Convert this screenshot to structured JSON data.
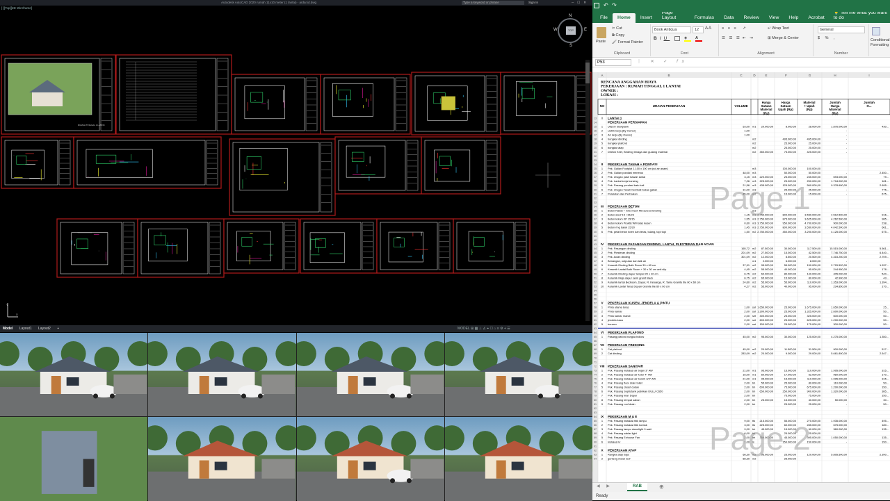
{
  "cad": {
    "title": "Autodesk AutoCAD 2020   rumah 11x10 meter (1 lantai) - ardar.id.dwg",
    "search_placeholder": "Type a keyword or phrase",
    "sign_in": "Sign In",
    "viewport_label": "[-][Top][2D Wireframe]",
    "viewcube": {
      "face": "TOP",
      "n": "N",
      "s": "S",
      "e": "E",
      "w": "W"
    },
    "layout_tabs": [
      "Model",
      "Layout1",
      "Layout2",
      "+"
    ],
    "status_right": "MODEL  ⊞ ▦ ⊥ ∠ ⌖ ☐ ⌂ ≡ ⚙ + ☰",
    "sheet_caption": "RUMAH TINGGAL 1 LANTAI"
  },
  "excel": {
    "title_hint": "",
    "menu": [
      "File",
      "Home",
      "Insert",
      "Page Layout",
      "Formulas",
      "Data",
      "Review",
      "View",
      "Help",
      "Acrobat"
    ],
    "tell_me": "Tell me what you want to do",
    "clipboard": {
      "paste": "Paste",
      "cut": "Cut",
      "copy": "Copy",
      "painter": "Format Painter",
      "label": "Clipboard"
    },
    "font": {
      "name": "Book Antiqua",
      "size": "12",
      "label": "Font"
    },
    "alignment": {
      "wrap": "Wrap Text",
      "merge": "Merge & Center",
      "label": "Alignment"
    },
    "number": {
      "format": "General",
      "label": "Number"
    },
    "styles": {
      "cond": "Conditional Formatting",
      "label": ""
    },
    "name_box": "P53",
    "fx": "fx",
    "sheet_tab": "RAB",
    "status": "Ready",
    "watermark": [
      "Page 1",
      "Page 2"
    ],
    "rab": {
      "title": "RENCANA ANGGARAN BIAYA",
      "pekerjaan": "PEKERJAAN : RUMAH TINGGAL 1 LANTAI",
      "owner": "OWNER        :",
      "lokasi": "LOKASI       :",
      "headers": [
        "NO",
        "URAIAN PEKERJAAN",
        "VOLUME",
        "",
        "Harga Satuan Material (Rp)",
        "Harga Satuan Upah (Rp)",
        "Material + Upah (Rp)",
        "Jumlah Harga Material (Rp)",
        "Jumlah H..."
      ],
      "rows": [
        [
          "I",
          "LANTAI 1",
          "",
          "",
          "",
          "",
          "",
          "",
          ""
        ],
        [
          "",
          "PEKERJAAN PERSIAPAN",
          "",
          "",
          "",
          "",
          "",
          "",
          ""
        ],
        [
          "1",
          "Uitzet / Bowplank",
          "53,00",
          "m1",
          "20.000,00",
          "8.000,00",
          "28.000,00",
          "1.876.000,00",
          "430..."
        ],
        [
          "2",
          "Listrik kerja (By Owner)",
          "1,00",
          "",
          "",
          "",
          "",
          "-",
          ""
        ],
        [
          "3",
          "Air kerja (By Owner)",
          "1,00",
          "",
          "",
          "",
          "",
          "-",
          ""
        ],
        [
          "4",
          "bongkar dinding",
          "",
          "m2",
          "",
          "495.000,00",
          "495.000,00",
          "-",
          ""
        ],
        [
          "5",
          "bongkar plafond",
          "",
          "m2",
          "",
          "25.000,00",
          "25.000,00",
          "-",
          ""
        ],
        [
          "6",
          "bongkar atap",
          "",
          "m2",
          "",
          "25.000,00",
          "25.000,00",
          "-",
          ""
        ],
        [
          "7",
          "Direksi Keet, Bedeng tenaga dan gudang material",
          "",
          "m2",
          "350.000,00",
          "75.000,00",
          "425.000,00",
          "-",
          ""
        ],
        [
          "",
          "",
          "",
          "",
          "",
          "",
          "",
          "",
          ""
        ],
        [
          "",
          "",
          "",
          "",
          "",
          "",
          "",
          "",
          ""
        ],
        [
          "II",
          "PEKERJAAN TANAH + PONDASI",
          "",
          "",
          "",
          "",
          "",
          "",
          ""
        ],
        [
          "1",
          "Pek. Galian Footplat 1.100 x 100 cm (sd air asam)",
          "",
          "m3",
          "",
          "100.000,00",
          "100.000,00",
          "",
          ""
        ],
        [
          "2",
          "Pek. Galian pondasi menerus",
          "48,00",
          "m3",
          "",
          "50.000,00",
          "50.000,00",
          "-",
          "2.450..."
        ],
        [
          "3",
          "Pek. Urugan pasir bawah lantai",
          "3,15",
          "m3",
          "220.000,00",
          "25.000,00",
          "245.000,00",
          "693.000,00",
          "79..."
        ],
        [
          "4",
          "Pek. Lantai kerja bonsing",
          "7,26",
          "m3",
          "225.000,00",
          "25.000,00",
          "250.000,00",
          "1.704.000,00",
          "181..."
        ],
        [
          "5",
          "Pek. Pasang pondasi batu kali",
          "21,56",
          "m3",
          "435.000,00",
          "125.000,00",
          "560.000,00",
          "9.378.600,00",
          "2.695..."
        ],
        [
          "6",
          "Pek. Urugan Tanah Kembali bekas galian",
          "31,00",
          "m3",
          "",
          "25.000,00",
          "25.000,00",
          "-",
          "775..."
        ],
        [
          "7",
          "Peralatan dan Perbaikan",
          "45,00",
          "m2",
          "",
          "15.000,00",
          "15.000,00",
          "-",
          "675..."
        ],
        [
          "",
          "",
          "",
          "",
          "",
          "",
          "",
          "",
          ""
        ],
        [
          "",
          "",
          "",
          "",
          "",
          "",
          "",
          "",
          ""
        ],
        [
          "III",
          "PEKERJAAN BETON",
          "",
          "",
          "",
          "",
          "",
          "",
          ""
        ],
        [
          "1",
          "Beton Rabat + wire mesh M8 screed leveling",
          "",
          "m3",
          "",
          "",
          "",
          "",
          ""
        ],
        [
          "2",
          "Beton sloof 15 / 15/23",
          "1,15",
          "m3",
          "2.750.000,00",
          "800.000,00",
          "3.550.000,00",
          "4.512.500,00",
          "916..."
        ],
        [
          "3",
          "Beton kolom KP 15/15",
          "1,55",
          "m3",
          "2.750.000,00",
          "875.000,00",
          "3.625.000,00",
          "4.262.500,00",
          "985..."
        ],
        [
          "4",
          "Beton kolom Praktis WM atas kusen",
          "0,60",
          "m3",
          "3.750.000,00",
          "950.000,00",
          "4.700.000,00",
          "900.000,00",
          "238..."
        ],
        [
          "5",
          "Beton ring balok 15/20",
          "1,45",
          "m3",
          "2.750.000,00",
          "800.000,00",
          "3.550.000,00",
          "4.042.500,00",
          "661..."
        ],
        [
          "6",
          "Pek. pelat beton toren dan teras, tulang, topi topi",
          "1,50",
          "m2",
          "2.750.000,00",
          "450.000,00",
          "3.200.000,00",
          "4.125.000,00",
          "675..."
        ],
        [
          "",
          "",
          "",
          "",
          "",
          "",
          "",
          "",
          ""
        ],
        [
          "",
          "",
          "",
          "",
          "",
          "",
          "",
          "",
          ""
        ],
        [
          "IV",
          "PEKERJAAN PASANGAN DINDING, LANTAI, PLESTERAN DAN ACIAN",
          "",
          "",
          "",
          "",
          "",
          "",
          ""
        ],
        [
          "1",
          "Pek. Pasangan dinding",
          "165,72",
          "m2",
          "87.500,00",
          "30.000,00",
          "117.500,00",
          "15.515.000,00",
          "5.561..."
        ],
        [
          "2",
          "Pek. Plesteran dinding",
          "201,09",
          "m2",
          "27.500,00",
          "15.000,00",
          "42.500,00",
          "7.746.750,00",
          "6.440..."
        ],
        [
          "3",
          "Pek. Acian dinding",
          "301,09",
          "m2",
          "12.000,00",
          "8.500,00",
          "20.500,00",
          "4.315.250,00",
          "2.709..."
        ],
        [
          "4",
          "Benangan, outputan dan talk air",
          "",
          "m1",
          "2.000,00",
          "6.000,00",
          "8.000,00",
          "-",
          ""
        ],
        [
          "5",
          "Keramik Dinding Bath Room 30 x 60 cm",
          "37,91",
          "m2",
          "95.000,00",
          "55.000,00",
          "150.000,00",
          "2.729.520,00",
          "1.937..."
        ],
        [
          "6",
          "Keramik Lantai Bath Room + 30 x 30 cm anti slip",
          "4,45",
          "m2",
          "55.000,00",
          "40.000,00",
          "95.000,00",
          "244.950,00",
          "178..."
        ],
        [
          "7",
          "Keramik Dinding dapur tempat 20 x 40 cm",
          "6,75",
          "m2",
          "60.000,00",
          "80.000,00",
          "140.000,00",
          "405.000,00",
          "540..."
        ],
        [
          "8",
          "Keramik Meja dapur semi granit black",
          "6,75",
          "m2",
          "65.000,00",
          "15.000,00",
          "80.000,00",
          "42.900,00",
          "43..."
        ],
        [
          "9",
          "Keramik lantai Bedroom, Dapur, R. Keluarga, R. Tamu Granite tile 60 x 60 cm",
          "24,60",
          "m2",
          "55.000,00",
          "55.000,00",
          "110.000,00",
          "1.353.000,00",
          "1.394..."
        ],
        [
          "10",
          "Keramik Lantai Teras Depan Granite tile 60 x 60 cm",
          "4,27",
          "m2",
          "55.000,00",
          "40.000,00",
          "95.000,00",
          "234.850,00",
          "170..."
        ],
        [
          "",
          "",
          "",
          "",
          "",
          "",
          "",
          "",
          ""
        ],
        [
          "",
          "",
          "",
          "",
          "",
          "",
          "",
          "",
          ""
        ],
        [
          "",
          "",
          "",
          "",
          "",
          "",
          "",
          "",
          ""
        ],
        [
          "V",
          "PEKERJAAN KUSEN, JENDELA & PINTU",
          "",
          "",
          "",
          "",
          "",
          "",
          ""
        ],
        [
          "1",
          "Pintu utama teras",
          "1,00",
          "set",
          "1.650.000,00",
          "25.000,00",
          "1.675.000,00",
          "1.650.000,00",
          "25..."
        ],
        [
          "2",
          "Pintu kamar",
          "2,00",
          "set",
          "1.300.000,00",
          "25.000,00",
          "1.325.000,00",
          "2.600.000,00",
          "50..."
        ],
        [
          "3",
          "Pintu kamar mandi",
          "2,00",
          "set",
          "300.000,00",
          "25.000,00",
          "325.000,00",
          "600.000,00",
          "50..."
        ],
        [
          "4",
          "jendela kaca",
          "2,00",
          "set",
          "600.000,00",
          "25.000,00",
          "625.000,00",
          "1.200.000,00",
          "50..."
        ],
        [
          "5",
          "bouven",
          "2,00",
          "set",
          "150.000,00",
          "25.000,00",
          "175.000,00",
          "300.000,00",
          "50..."
        ],
        [
          "",
          "",
          "",
          "",
          "",
          "",
          "",
          "",
          ""
        ],
        [
          "VI",
          "PEKERJAAN PLAFOND",
          "",
          "",
          "",
          "",
          "",
          "",
          ""
        ],
        [
          "1",
          "Pasang plafond rangka hollow",
          "45,00",
          "m2",
          "95.000,00",
          "30.000,00",
          "125.000,00",
          "4.275.000,00",
          "1.350..."
        ],
        [
          "",
          "",
          "",
          "",
          "",
          "",
          "",
          "",
          ""
        ],
        [
          "VII",
          "PEKERJAAN FINISHING",
          "",
          "",
          "",
          "",
          "",
          "",
          ""
        ],
        [
          "1",
          "Cat plafond",
          "45,00",
          "m2",
          "20.000,00",
          "11.500,00",
          "31.500,00",
          "900.000,00",
          "517..."
        ],
        [
          "2",
          "Cat dinding",
          "283,09",
          "m2",
          "20.000,00",
          "9.000,00",
          "29.000,00",
          "5.661.800,00",
          "2.547..."
        ],
        [
          "",
          "",
          "",
          "",
          "",
          "",
          "",
          "",
          ""
        ],
        [
          "",
          "",
          "",
          "",
          "",
          "",
          "",
          "",
          ""
        ],
        [
          "VIII",
          "PEKERJAAN SANITAIR",
          "",
          "",
          "",
          "",
          "",
          "",
          ""
        ],
        [
          "1",
          "Pek. Pasang instalasi air bejan 3\" AW",
          "21,00",
          "m1",
          "95.000,00",
          "15.000,00",
          "110.000,00",
          "1.995.000,00",
          "315..."
        ],
        [
          "2",
          "Pek. Pasang instalasi air kotor 4\" AW",
          "16,00",
          "m1",
          "60.000,00",
          "17.000,00",
          "62.000,00",
          "960.000,00",
          "170..."
        ],
        [
          "3",
          "Pek. Pasang instalasi air bersih 3/4\" AW",
          "21,00",
          "m1",
          "95.000,00",
          "15.000,00",
          "110.000,00",
          "1.995.000,00",
          "315..."
        ],
        [
          "4",
          "Pek. Pasang floor drain toilet",
          "2,00",
          "bh",
          "55.000,00",
          "25.000,00",
          "80.000,00",
          "110.000,00",
          "50..."
        ],
        [
          "5",
          "Pek. Pasang closet duduk",
          "2,00",
          "bh",
          "600.000,00",
          "75.000,00",
          "675.000,00",
          "1.200.000,00",
          "150..."
        ],
        [
          "6",
          "Pek. Pasang Septictank pabrikan DULU C650",
          "2,00",
          "bh",
          "650.000,00",
          "250.000,00",
          "900.000,00",
          "1.320.000,00",
          "385..."
        ],
        [
          "7",
          "Pek. Pasang kran Dapur",
          "2,00",
          "bh",
          "",
          "75.000,00",
          "75.000,00",
          "-",
          "150..."
        ],
        [
          "8",
          "Pek. Pasang tempat sabun",
          "2,00",
          "bh",
          "25.000,00",
          "15.000,00",
          "40.000,00",
          "50.000,00",
          "30..."
        ],
        [
          "9",
          "Pek. Pasang roof drain",
          "2,00",
          "bh",
          "",
          "25.000,00",
          "25.000,00",
          "-",
          "50..."
        ],
        [
          "",
          "",
          "",
          "",
          "",
          "",
          "",
          "",
          ""
        ],
        [
          "",
          "",
          "",
          "",
          "",
          "",
          "",
          "",
          ""
        ],
        [
          "IX",
          "PEKERJAAN M & E",
          "",
          "",
          "",
          "",
          "",
          "",
          ""
        ],
        [
          "1",
          "Pek. Pasang instalasi titik lampu",
          "9,00",
          "ttk",
          "215.000,00",
          "55.000,00",
          "270.000,00",
          "1.935.000,00",
          "495..."
        ],
        [
          "2",
          "Pek. Pasang instalasi titik kontak",
          "3,00",
          "ttk",
          "225.000,00",
          "60.000,00",
          "285.000,00",
          "675.000,00",
          "180..."
        ],
        [
          "3",
          "Pek. Pasang lampu downlight 9 watt",
          "9,00",
          "bh",
          "45.000,00",
          "15.000,00",
          "60.000,00",
          "360.000,00",
          "135..."
        ],
        [
          "4",
          "Pek. Pasang saklar light",
          "6,00",
          "bh",
          "",
          "25.000,00",
          "25.000,00",
          "-",
          ""
        ],
        [
          "5",
          "Pek. Pasang Exhouse Fan",
          "2,00",
          "bh",
          "350.000,00",
          "45.000,00",
          "395.000,00",
          "1.050.000,00",
          "135..."
        ],
        [
          "6",
          "Instalasi tv",
          "1,00",
          "ls",
          "",
          "150.000,00",
          "150.000,00",
          "-",
          "150..."
        ],
        [
          "",
          "",
          "",
          "",
          "",
          "",
          "",
          "",
          ""
        ],
        [
          "X",
          "PEKERJAAN ATAP",
          "",
          "",
          "",
          "",
          "",
          "",
          ""
        ],
        [
          "1",
          "Rangka atap baja",
          "68,30",
          "m2",
          "95.000,00",
          "25.000,00",
          "120.000,00",
          "5.805.500,00",
          "2.390..."
        ],
        [
          "2",
          "genteng metal roof",
          "68,30",
          "m2",
          "",
          "25.000,00",
          "",
          "",
          ""
        ]
      ]
    }
  },
  "colors": {
    "excel_green": "#217346",
    "cad_frame": "#b11a1a"
  }
}
